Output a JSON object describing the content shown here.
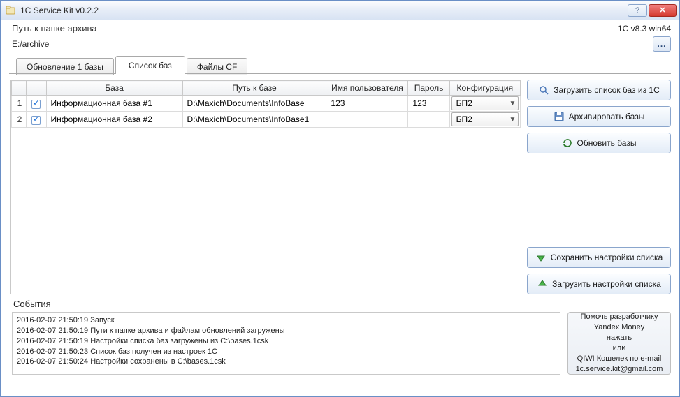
{
  "window": {
    "title": "1C Service Kit v0.2.2",
    "help_btn": "?",
    "close_btn": "✕"
  },
  "header": {
    "archive_path_label": "Путь к папке архива",
    "version_text": "1C v8.3 win64",
    "archive_path_value": "E:/archive",
    "browse_btn": "..."
  },
  "tabs": [
    {
      "label": "Обновление 1 базы"
    },
    {
      "label": "Список баз"
    },
    {
      "label": "Файлы CF"
    }
  ],
  "grid": {
    "columns": {
      "base": "База",
      "path": "Путь к базе",
      "user": "Имя пользователя",
      "pwd": "Пароль",
      "config": "Конфигурация"
    },
    "rows": [
      {
        "n": "1",
        "checked": true,
        "name": "Информационная база #1",
        "path": "D:\\Maxich\\Documents\\InfoBase",
        "user": "123",
        "pwd": "123",
        "config": "БП2"
      },
      {
        "n": "2",
        "checked": true,
        "name": "Информационная база #2",
        "path": "D:\\Maxich\\Documents\\InfoBase1",
        "user": "",
        "pwd": "",
        "config": "БП2"
      }
    ]
  },
  "buttons": {
    "load_list": "Загрузить список баз из 1С",
    "archive": "Архивировать базы",
    "update": "Обновить базы",
    "save_settings": "Сохранить настройки списка",
    "load_settings": "Загрузить настройки списка"
  },
  "events": {
    "label": "События",
    "lines": [
      "2016-02-07 21:50:19 Запуск",
      "2016-02-07 21:50:19 Пути к папке архива и файлам обновлений загружены",
      "2016-02-07 21:50:19 Настройки списка баз загружены из C:\\bases.1csk",
      "2016-02-07 21:50:23 Список баз получен из настроек 1С",
      "2016-02-07 21:50:24 Настройки сохранены в C:\\bases.1csk"
    ]
  },
  "helpbox": {
    "l1": "Помочь разработчику",
    "l2": "Yandex Money",
    "l3": "нажать",
    "l4": "или",
    "l5": "QIWI Кошелек по e-mail",
    "l6": "1c.service.kit@gmail.com"
  }
}
